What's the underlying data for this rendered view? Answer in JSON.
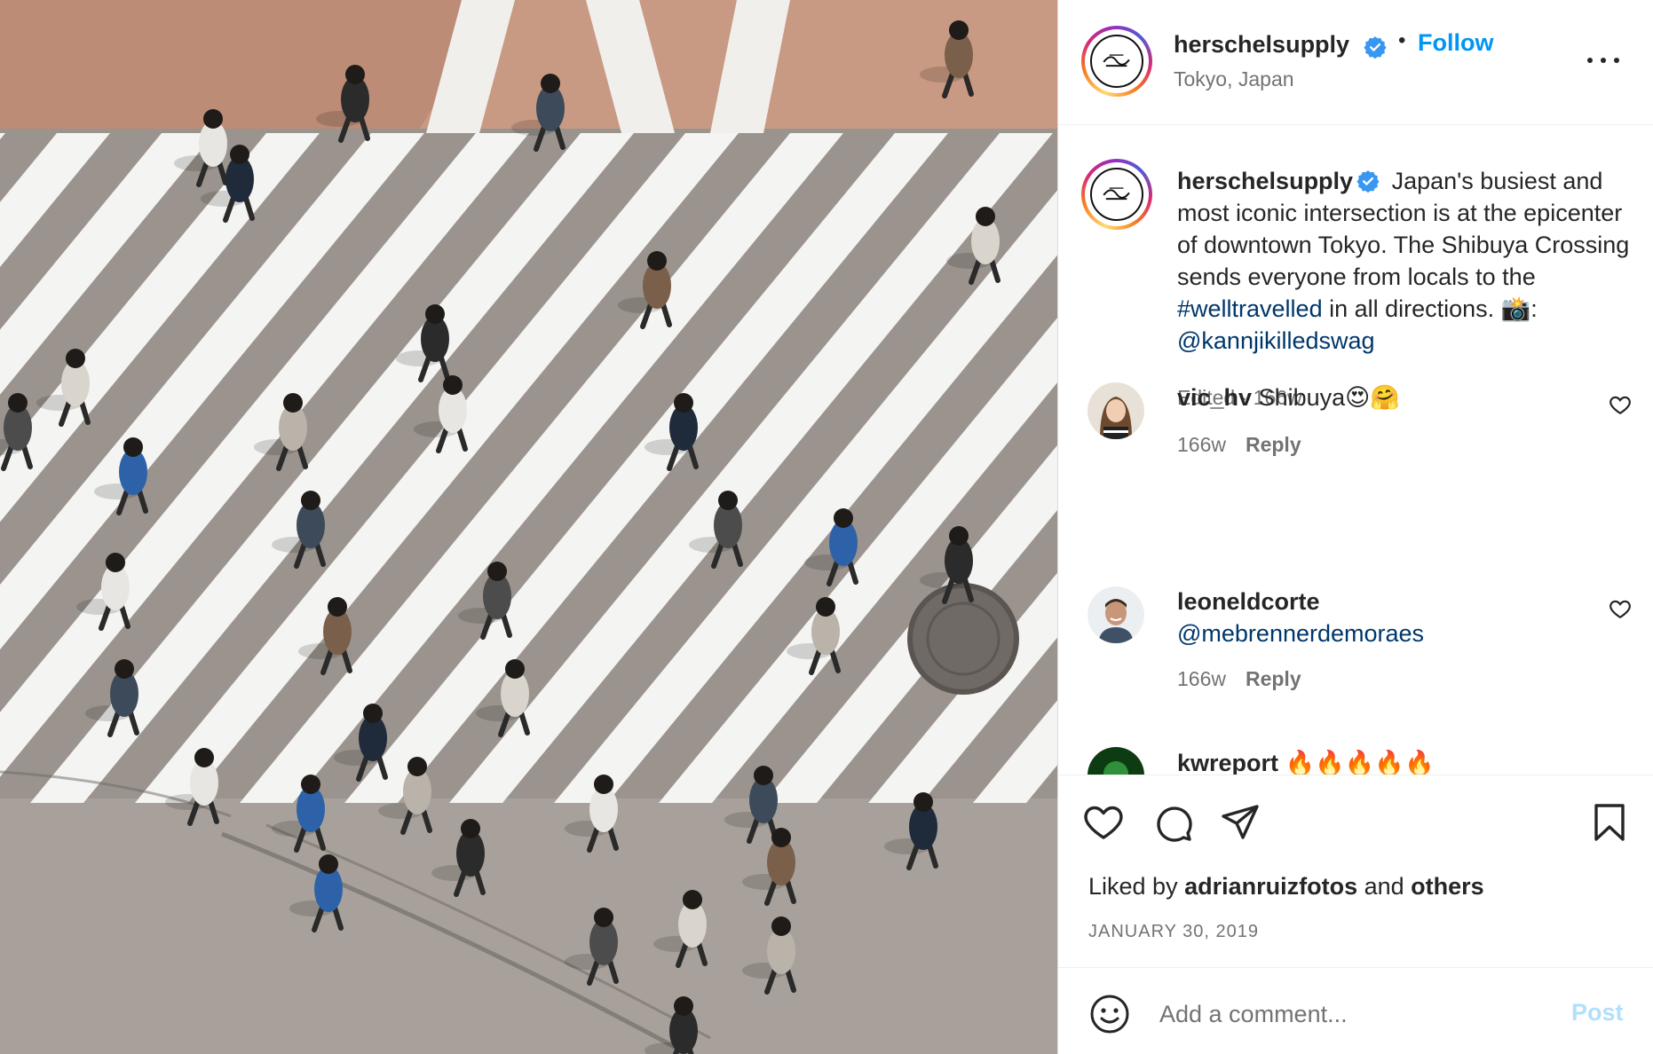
{
  "photo": {
    "alt_icon": "photo-crosswalk",
    "colors": {
      "asphalt": "#a39c96",
      "stripe": "#f4f4f2",
      "brick": "#c99a83"
    }
  },
  "header": {
    "username": "herschelsupply",
    "verified": true,
    "dot": "•",
    "follow_label": "Follow",
    "location": "Tokyo, Japan"
  },
  "caption": {
    "username": "herschelsupply",
    "text_1": " Japan's busiest and most iconic intersection is at the epicenter of downtown Tokyo. The Shibuya Crossing sends everyone from locals to the ",
    "hashtag": "#welltravelled",
    "text_2": " in all directions. 📸: ",
    "mention": "@kannjikilledswag",
    "meta": "Edited · 166w"
  },
  "comments": [
    {
      "username": "vic_hv",
      "text": " Shibuya😍🤗",
      "time": "166w",
      "reply": "Reply"
    },
    {
      "username": "leoneldcorte",
      "mention": "@mebrennerdemoraes",
      "time": "166w",
      "reply": "Reply"
    },
    {
      "username": "kwreport",
      "text": " 🔥🔥🔥🔥🔥"
    }
  ],
  "actions": {
    "liked_prefix": "Liked by ",
    "liked_user": "adrianruizfotos",
    "liked_and": " and ",
    "liked_others": "others",
    "date": "JANUARY 30, 2019"
  },
  "add_comment": {
    "placeholder": "Add a comment...",
    "post_label": "Post"
  },
  "colors": {
    "accent": "#0095f6",
    "link": "#00376b",
    "muted": "#737373",
    "verified": "#3897f0"
  }
}
